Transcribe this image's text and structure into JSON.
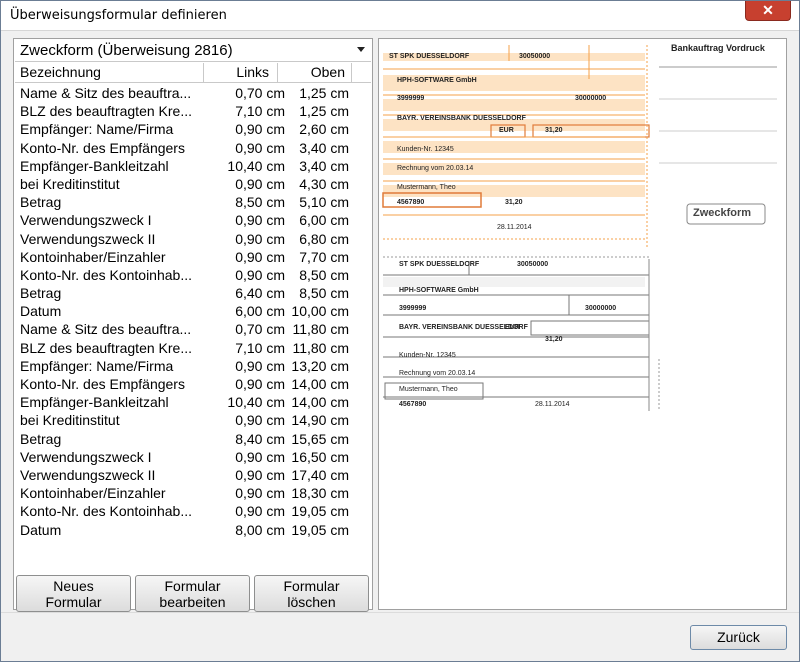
{
  "window": {
    "title": "Überweisungsformular definieren",
    "close_glyph": "✕"
  },
  "form_select": {
    "value": "Zweckform (Überweisung 2816)"
  },
  "table": {
    "headers": {
      "name": "Bezeichnung",
      "links": "Links",
      "oben": "Oben"
    },
    "rows": [
      {
        "name": "Name & Sitz des beauftra...",
        "links": "0,70 cm",
        "oben": "1,25 cm"
      },
      {
        "name": "BLZ des beauftragten Kre...",
        "links": "7,10 cm",
        "oben": "1,25 cm"
      },
      {
        "name": "Empfänger: Name/Firma",
        "links": "0,90 cm",
        "oben": "2,60 cm"
      },
      {
        "name": "Konto-Nr. des Empfängers",
        "links": "0,90 cm",
        "oben": "3,40 cm"
      },
      {
        "name": "Empfänger-Bankleitzahl",
        "links": "10,40 cm",
        "oben": "3,40 cm"
      },
      {
        "name": "bei Kreditinstitut",
        "links": "0,90 cm",
        "oben": "4,30 cm"
      },
      {
        "name": "Betrag",
        "links": "8,50 cm",
        "oben": "5,10 cm"
      },
      {
        "name": "Verwendungszweck I",
        "links": "0,90 cm",
        "oben": "6,00 cm"
      },
      {
        "name": "Verwendungszweck II",
        "links": "0,90 cm",
        "oben": "6,80 cm"
      },
      {
        "name": "Kontoinhaber/Einzahler",
        "links": "0,90 cm",
        "oben": "7,70 cm"
      },
      {
        "name": "Konto-Nr. des Kontoinhab...",
        "links": "0,90 cm",
        "oben": "8,50 cm"
      },
      {
        "name": "Betrag",
        "links": "6,40 cm",
        "oben": "8,50 cm"
      },
      {
        "name": "Datum",
        "links": "6,00 cm",
        "oben": "10,00 cm"
      },
      {
        "name": "Name & Sitz des beauftra...",
        "links": "0,70 cm",
        "oben": "11,80 cm"
      },
      {
        "name": "BLZ des beauftragten Kre...",
        "links": "7,10 cm",
        "oben": "11,80 cm"
      },
      {
        "name": "Empfänger: Name/Firma",
        "links": "0,90 cm",
        "oben": "13,20 cm"
      },
      {
        "name": "Konto-Nr. des Empfängers",
        "links": "0,90 cm",
        "oben": "14,00 cm"
      },
      {
        "name": "Empfänger-Bankleitzahl",
        "links": "10,40 cm",
        "oben": "14,00 cm"
      },
      {
        "name": "bei Kreditinstitut",
        "links": "0,90 cm",
        "oben": "14,90 cm"
      },
      {
        "name": "Betrag",
        "links": "8,40 cm",
        "oben": "15,65 cm"
      },
      {
        "name": "Verwendungszweck I",
        "links": "0,90 cm",
        "oben": "16,50 cm"
      },
      {
        "name": "Verwendungszweck II",
        "links": "0,90 cm",
        "oben": "17,40 cm"
      },
      {
        "name": "Kontoinhaber/Einzahler",
        "links": "0,90 cm",
        "oben": "18,30 cm"
      },
      {
        "name": "Konto-Nr. des Kontoinhab...",
        "links": "0,90 cm",
        "oben": "19,05 cm"
      },
      {
        "name": "Datum",
        "links": "8,00 cm",
        "oben": "19,05 cm"
      }
    ]
  },
  "buttons": {
    "new": {
      "line1": "Neues",
      "line2": "Formular"
    },
    "edit": {
      "line1": "Formular",
      "line2": "bearbeiten"
    },
    "delete": {
      "line1": "Formular",
      "line2": "löschen"
    },
    "back": "Zurück"
  },
  "preview": {
    "colors": {
      "orange": "#f5a04a",
      "orange_light": "#fde3c4",
      "grey_line": "#777777"
    },
    "upper": {
      "bank_name": "ST SPK DUESSELDORF",
      "bank_blz": "30050000",
      "recipient": "HPH-SOFTWARE GmbH",
      "account": "3999999",
      "recipient_blz": "30000000",
      "recipient_bank": "BAYR. VEREINSBANK DUESSELDORF",
      "currency": "EUR",
      "amount": "31,20",
      "purpose1": "Kunden-Nr. 12345",
      "purpose2": "Rechnung vom 20.03.14",
      "payer": "Mustermann, Theo",
      "payer_account": "4567890",
      "payer_amount": "31,20",
      "date": "28.11.2014",
      "side_title": "Bankauftrag Vordruck",
      "brand": "Zweckform"
    },
    "lower": {
      "bank_name": "ST SPK DUESSELDORF",
      "bank_blz": "30050000",
      "recipient": "HPH-SOFTWARE GmbH",
      "account": "3999999",
      "recipient_blz": "30000000",
      "recipient_bank": "BAYR. VEREINSBANK DUESSELDORF",
      "currency": "EUR",
      "amount": "31,20",
      "purpose1": "Kunden-Nr. 12345",
      "purpose2": "Rechnung vom 20.03.14",
      "payer": "Mustermann, Theo",
      "payer_account": "4567890",
      "date": "28.11.2014"
    }
  }
}
